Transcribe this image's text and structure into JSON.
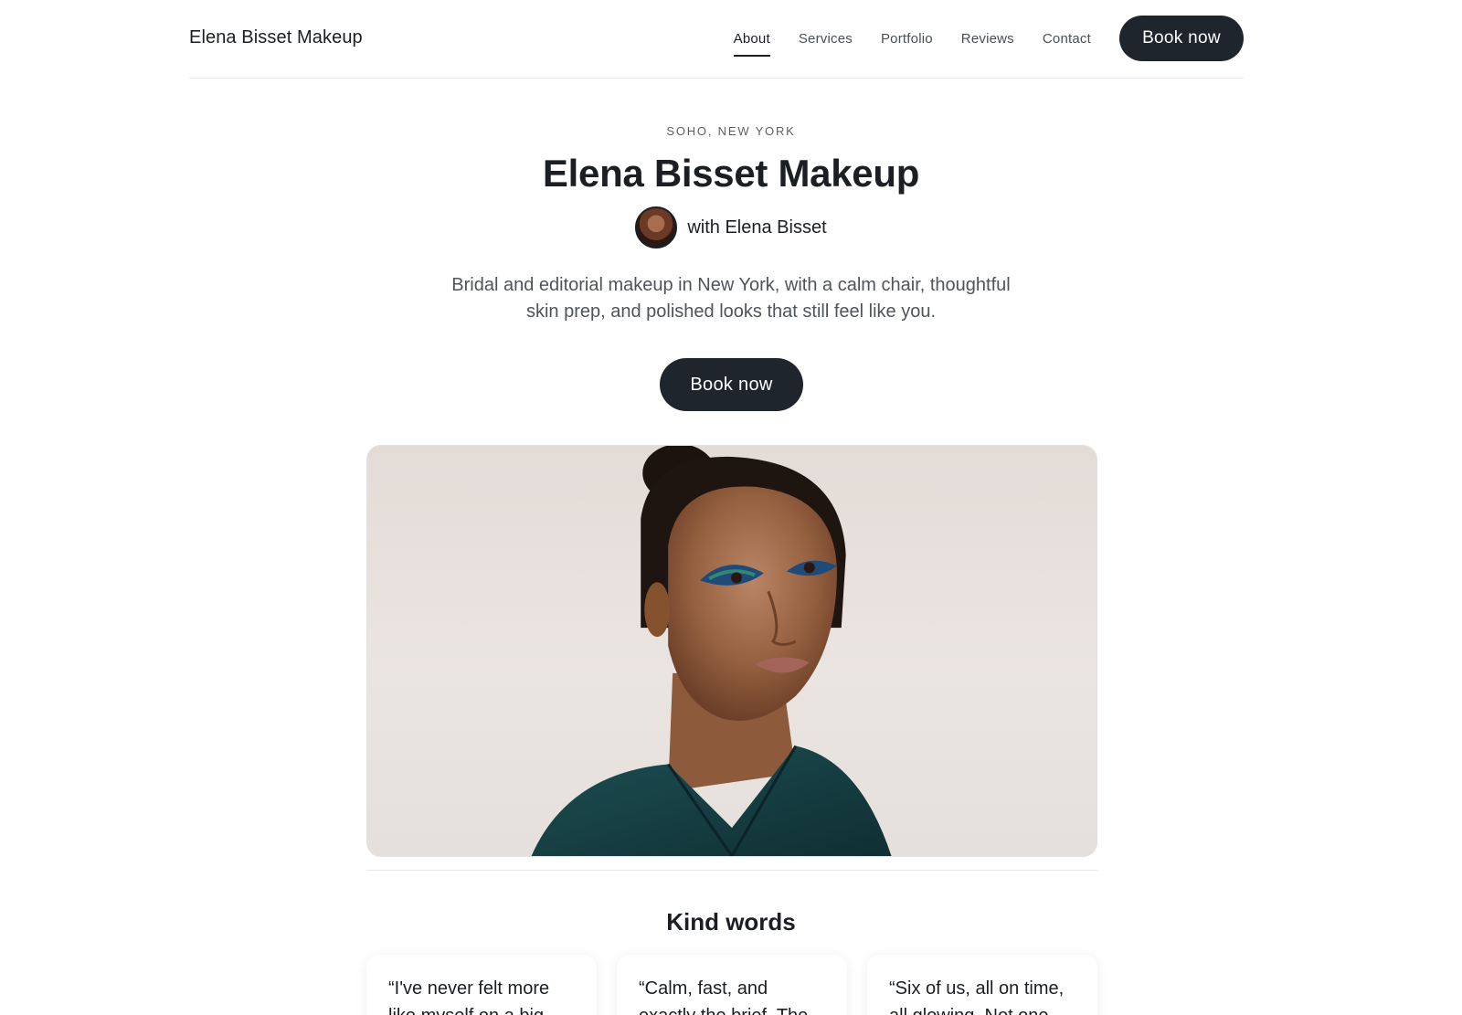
{
  "header": {
    "brand": "Elena Bisset Makeup",
    "nav": [
      "About",
      "Services",
      "Portfolio",
      "Reviews",
      "Contact"
    ],
    "active_nav": "About",
    "cta": "Book now"
  },
  "hero": {
    "eyebrow": "SOHO, NEW YORK",
    "title": "Elena Bisset Makeup",
    "byline": "with Elena Bisset",
    "intro": "Bridal and editorial makeup in New York, with a calm chair, thoughtful skin prep, and polished looks that still feel like you.",
    "cta": "Book now"
  },
  "reviews": {
    "title": "Kind words",
    "items": [
      "“I've never felt more like myself on a big",
      "“Calm, fast, and exactly the brief. The",
      "“Six of us, all on time, all glowing. Not one"
    ]
  },
  "colors": {
    "button": "#1e252d",
    "text": "#1b1f24",
    "muted": "#4f545a",
    "hero_bg": "#e6e0dc",
    "jacket": "#143b3f"
  }
}
